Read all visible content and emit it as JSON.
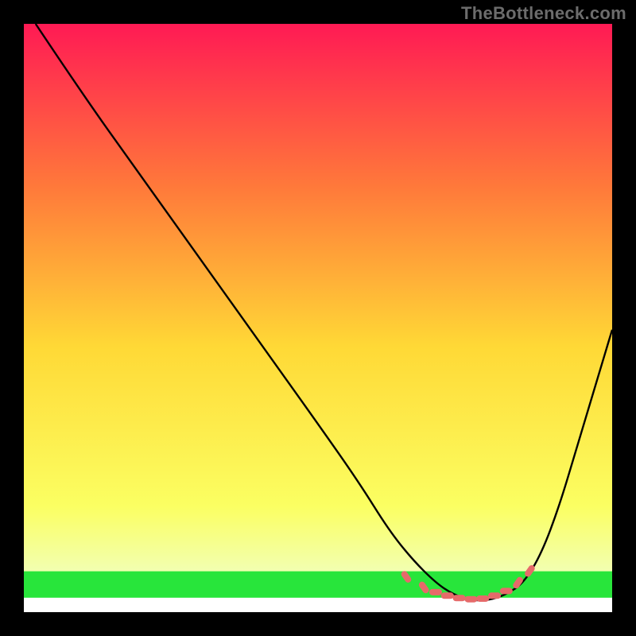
{
  "attribution": "TheBottleneck.com",
  "chart_data": {
    "type": "line",
    "title": "",
    "xlabel": "",
    "ylabel": "",
    "xlim": [
      0,
      100
    ],
    "ylim": [
      0,
      100
    ],
    "background_gradient": {
      "top": "#ff1a54",
      "mid_upper": "#ff7a3a",
      "mid": "#ffd936",
      "mid_lower": "#fbff62",
      "green_band": "#28e53b",
      "bottom": "#ffffff"
    },
    "series": [
      {
        "name": "bottleneck-curve",
        "color": "#000000",
        "x": [
          2,
          10,
          20,
          30,
          40,
          50,
          57,
          62,
          66,
          70,
          73,
          76,
          79,
          82,
          85,
          88,
          91,
          94,
          97,
          100
        ],
        "y": [
          100,
          88,
          74,
          60,
          46,
          32,
          22,
          14,
          9,
          5,
          3,
          2,
          2,
          3,
          5,
          10,
          18,
          28,
          38,
          48
        ]
      }
    ],
    "markers": {
      "name": "optimal-range",
      "color": "#e66a6a",
      "points": [
        {
          "x": 65,
          "y": 6.0
        },
        {
          "x": 68,
          "y": 4.2
        },
        {
          "x": 70,
          "y": 3.4
        },
        {
          "x": 72,
          "y": 2.8
        },
        {
          "x": 74,
          "y": 2.4
        },
        {
          "x": 76,
          "y": 2.2
        },
        {
          "x": 78,
          "y": 2.3
        },
        {
          "x": 80,
          "y": 2.8
        },
        {
          "x": 82,
          "y": 3.6
        },
        {
          "x": 84,
          "y": 5.0
        },
        {
          "x": 86,
          "y": 7.0
        }
      ]
    }
  }
}
